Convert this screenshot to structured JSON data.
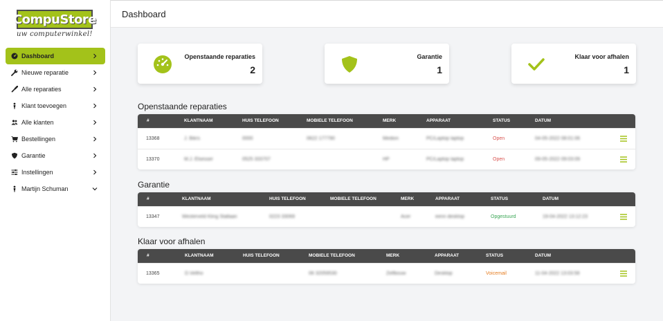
{
  "brand": {
    "name": "CompuStore",
    "tagline": "uw computerwinkel!",
    "accent": "#a3c21a"
  },
  "header": {
    "title": "Dashboard"
  },
  "sidebar": {
    "items": [
      {
        "label": "Dashboard",
        "icon": "dashboard-icon",
        "active": true
      },
      {
        "label": "Nieuwe reparatie",
        "icon": "wrench-icon"
      },
      {
        "label": "Alle reparaties",
        "icon": "screwdriver-icon"
      },
      {
        "label": "Klant toevoegen",
        "icon": "user-icon"
      },
      {
        "label": "Alle klanten",
        "icon": "users-icon"
      },
      {
        "label": "Bestellingen",
        "icon": "cart-icon"
      },
      {
        "label": "Garantie",
        "icon": "shield-icon"
      },
      {
        "label": "Instellingen",
        "icon": "sliders-icon"
      },
      {
        "label": "Martijn Schuman",
        "icon": "user-icon",
        "expand": "chevron-down"
      }
    ]
  },
  "cards": [
    {
      "label": "Openstaande reparaties",
      "count": "2",
      "icon": "gauge-icon"
    },
    {
      "label": "Garantie",
      "count": "1",
      "icon": "shield-icon"
    },
    {
      "label": "Klaar voor afhalen",
      "count": "1",
      "icon": "check-icon"
    }
  ],
  "sections": {
    "open": {
      "title": "Openstaande reparaties",
      "columns": [
        "#",
        "KLANTNAAM",
        "HUIS TELEFOON",
        "MOBIELE TELEFOON",
        "MERK",
        "APPARAAT",
        "STATUS",
        "DATUM"
      ],
      "rows": [
        {
          "id": "13368",
          "name": "J. Bikrs",
          "home": "0000",
          "mobile": "0622 177790",
          "brand": "Medion",
          "device": "PC/Laptop laptop",
          "status": "Open",
          "date": "04-05-2022 08:01:06"
        },
        {
          "id": "13370",
          "name": "M.J. Elsesser",
          "home": "0525 333707",
          "mobile": "",
          "brand": "HP",
          "device": "PC/Laptop laptop",
          "status": "Open",
          "date": "09-05-2022 09:03:09"
        }
      ]
    },
    "warranty": {
      "title": "Garantie",
      "columns": [
        "#",
        "KLANTNAAM",
        "HUIS TELEFOON",
        "MOBIELE TELEFOON",
        "MERK",
        "APPARAAT",
        "STATUS",
        "DATUM"
      ],
      "rows": [
        {
          "id": "13347",
          "name": "Westerveld Kling Stallaan",
          "home": "0223 33069",
          "mobile": "",
          "brand": "Acer",
          "device": "eenn desktop",
          "status": "Opgestuurd",
          "date": "19-04-2022 13:12:23"
        }
      ]
    },
    "pickup": {
      "title": "Klaar voor afhalen",
      "columns": [
        "#",
        "KLANTNAAM",
        "HUIS TELEFOON",
        "MOBIELE TELEFOON",
        "MERK",
        "APPARAAT",
        "STATUS",
        "DATUM"
      ],
      "rows": [
        {
          "id": "13365",
          "name": "D.Veltho",
          "home": "",
          "mobile": "06 32059530",
          "brand": "Zelfbouw",
          "device": "Desktop",
          "status": "Voicemail",
          "date": "11-04-2022 13:03:58"
        }
      ]
    }
  }
}
